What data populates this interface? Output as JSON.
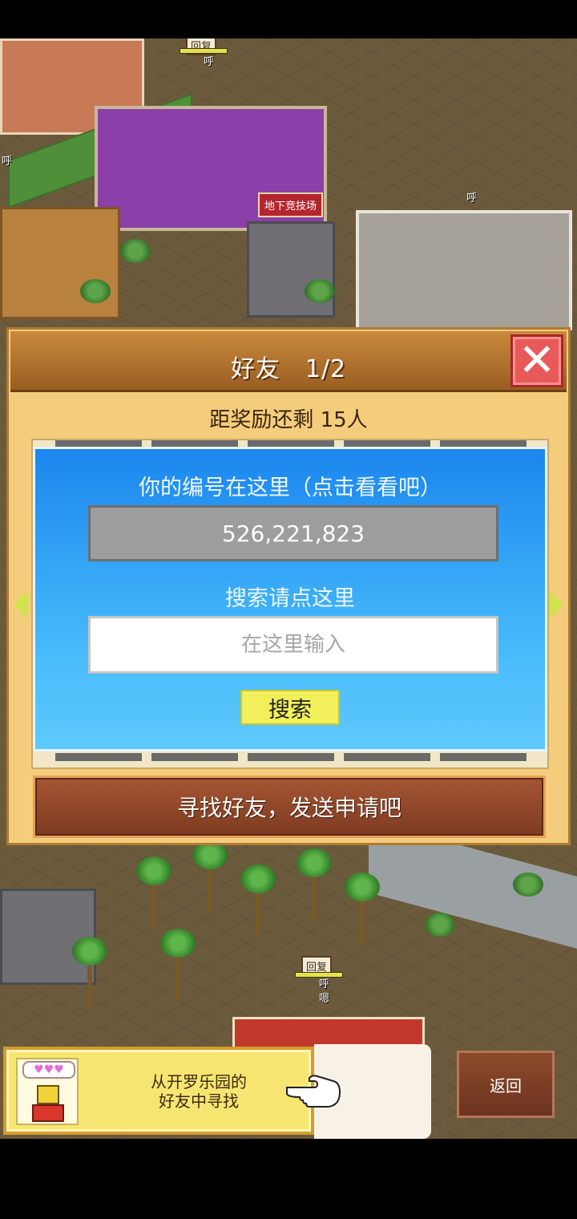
{
  "world": {
    "arena_sign": "地下竞技场",
    "status_tags": [
      "回复",
      "回复"
    ],
    "exclaims": [
      "呼",
      "呼",
      "呼",
      "呼",
      "嗯"
    ]
  },
  "dialog": {
    "title": "好友　1/2",
    "reward_text": "距奖励还剩 15人",
    "id_label": "你的编号在这里（点击看看吧）",
    "id_value": "526,221,823",
    "search_label": "搜索请点这里",
    "search_placeholder": "在这里输入",
    "search_button": "搜索",
    "find_button": "寻找好友，发送申请吧",
    "close_icon": "close-icon"
  },
  "bottom": {
    "hint_text": "从开罗乐园的\n好友中寻找",
    "hearts": "♥♥♥",
    "back_button": "返回",
    "pointer_icon": "pointing-hand-icon"
  },
  "colors": {
    "panel_blue": "#1b86ee",
    "close_red": "#e85a5a",
    "search_yellow": "#f2f05a",
    "dialog_bg": "#f4cd7c"
  }
}
